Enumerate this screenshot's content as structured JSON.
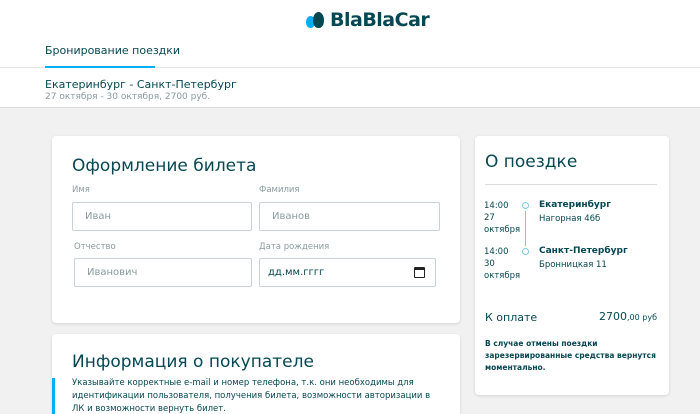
{
  "header": {
    "logo_text": "BlaBlaCar",
    "tab_label": "Бронирование поездки",
    "route": "Екатеринбург - Санкт-Петербург",
    "route_meta": "27 октября - 30 октября, 2700 руб."
  },
  "ticket_form": {
    "title": "Оформление билета",
    "first_name": {
      "label": "Имя",
      "placeholder": "Иван"
    },
    "last_name": {
      "label": "Фамилия",
      "placeholder": "Иванов"
    },
    "patronymic": {
      "label": "Отчество",
      "placeholder": "Иванович"
    },
    "birth_date": {
      "label": "Дата рождения",
      "placeholder": "дд.мм.гггг"
    }
  },
  "buyer_info": {
    "title": "Информация о покупателе",
    "note": "Указывайте корректные e-mail и номер телефона, т.к. они необходимы для идентификации пользователя, получения билета, возможности авторизации в ЛК и возможности вернуть билет."
  },
  "trip": {
    "title": "О поездке",
    "departure": {
      "time": "14:00",
      "day": "27",
      "month": "октября",
      "city": "Екатеринбург",
      "address": "Нагорная 46б"
    },
    "arrival": {
      "time": "14:00",
      "day": "30",
      "month": "октября",
      "city": "Санкт-Петербург",
      "address": "Бронницкая 11"
    },
    "pay_label": "К оплате",
    "pay_amount": "2700",
    "pay_cents": ",00 руб",
    "refund_note": "В случае отмены поездки зарезервированные средства вернутся моментально."
  },
  "colors": {
    "accent": "#00aff5",
    "text": "#054752",
    "muted": "#8a9ba1",
    "background": "#f1f1f1"
  }
}
